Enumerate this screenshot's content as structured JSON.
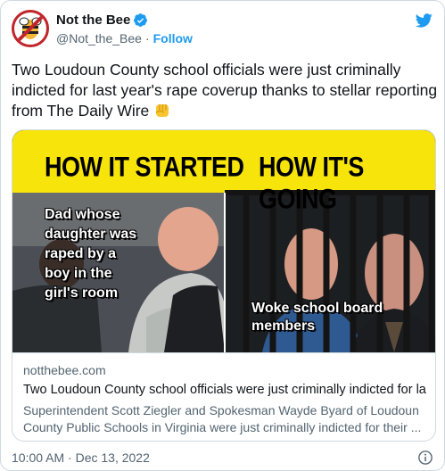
{
  "author": {
    "name": "Not the Bee",
    "handle": "@Not_the_Bee",
    "separator": "·",
    "follow_label": "Follow"
  },
  "icons": {
    "avatar": "bee-logo-icon",
    "verified": "verified-badge-icon",
    "brand": "twitter-bird-icon",
    "emoji": "raised-fist-emoji-icon",
    "info": "info-icon"
  },
  "tweet": {
    "text": "Two Loudoun County school officials were just criminally indicted for last year's rape coverup thanks to stellar reporting from The Daily Wire"
  },
  "card": {
    "media": {
      "left_heading": "HOW IT STARTED",
      "right_heading": "HOW IT'S GOING",
      "left_caption": "Dad whose daughter was raped by a boy in the girl's room",
      "right_caption": "Woke school board members"
    },
    "domain": "notthebee.com",
    "title": "Two Loudoun County school officials were just criminally indicted for las...",
    "description": "Superintendent Scott Ziegler and Spokesman Wayde Byard of Loudoun County Public Schools in Virginia were just criminally indicted for their ..."
  },
  "footer": {
    "timestamp": "10:00 AM · Dec 13, 2022"
  },
  "colors": {
    "accent": "#1d9bf0",
    "banner_yellow": "#f6e40b",
    "text": "#0f1419",
    "muted": "#536471",
    "border": "#cfd9de",
    "brand_red": "#c0252b"
  }
}
